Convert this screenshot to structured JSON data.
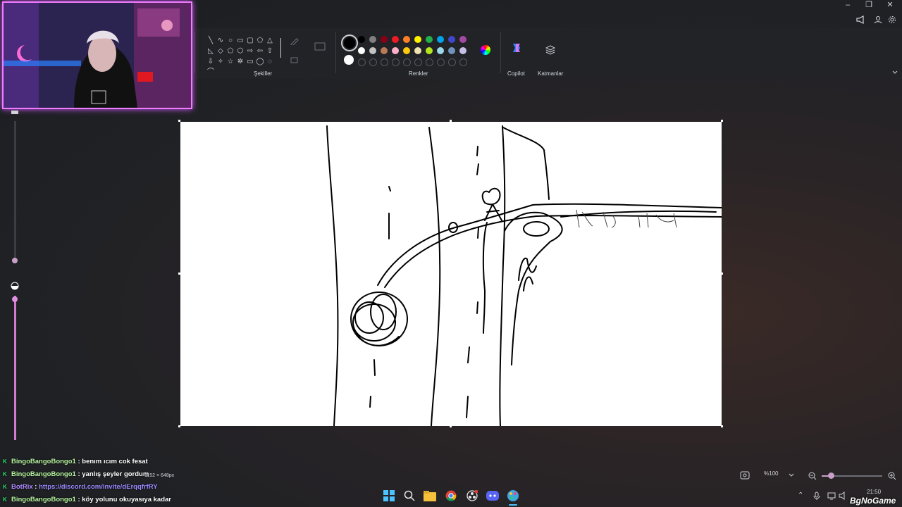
{
  "window": {
    "minimize": "–",
    "restore": "❐",
    "close": "✕",
    "header_icons": [
      "megaphone-icon",
      "profile-icon",
      "settings-icon"
    ]
  },
  "toolbar": {
    "shapes_label": "Şekiller",
    "colors_label": "Renkler",
    "copilot_label": "Copilot",
    "layers_label": "Katmanlar",
    "shapes": [
      "╲",
      "∿",
      "○",
      "▭",
      "▢",
      "⬠",
      "△",
      "◺",
      "◇",
      "⬠",
      "⬡",
      "⇨",
      "⇦",
      "⇧",
      "⇩",
      "✧",
      "☆",
      "✲",
      "▭",
      "◯",
      "◌",
      "⌒"
    ],
    "palette_row1": [
      "#000000",
      "#7f7f7f",
      "#880015",
      "#ed1c24",
      "#ff7f27",
      "#fff200",
      "#22b14c",
      "#00a2e8",
      "#3f48cc",
      "#a349a4"
    ],
    "palette_row2": [
      "#ffffff",
      "#c3c3c3",
      "#b97a57",
      "#ffaec9",
      "#ffc90e",
      "#efe4b0",
      "#b5e61d",
      "#99d9ea",
      "#7092be",
      "#c8bfe7"
    ],
    "primary_color": "#000000",
    "secondary_color": "#ffffff"
  },
  "canvas": {
    "dimensions_label": "1152 × 648px"
  },
  "statusbar": {
    "zoom_value": "%100"
  },
  "chat": [
    {
      "user": "BingoBangoBongo1",
      "text": " : benım ıcım cok fesat",
      "type": "user"
    },
    {
      "user": "BingoBangoBongo1",
      "text": " : yanlış şeyler gordum",
      "type": "user"
    },
    {
      "user": "BotRix",
      "text": " : ",
      "link": "https://discord.com/invite/dErqqfrfRY",
      "type": "bot"
    },
    {
      "user": "BingoBangoBongo1",
      "text": " : köy yolunu okuyasıya kadar",
      "type": "user"
    }
  ],
  "taskbar": {
    "apps": [
      "windows-start-icon",
      "search-icon",
      "file-explorer-icon",
      "chrome-icon",
      "obs-icon",
      "discord-icon",
      "paint-icon"
    ],
    "time": "21:50",
    "watermark": "BgNoGame"
  }
}
